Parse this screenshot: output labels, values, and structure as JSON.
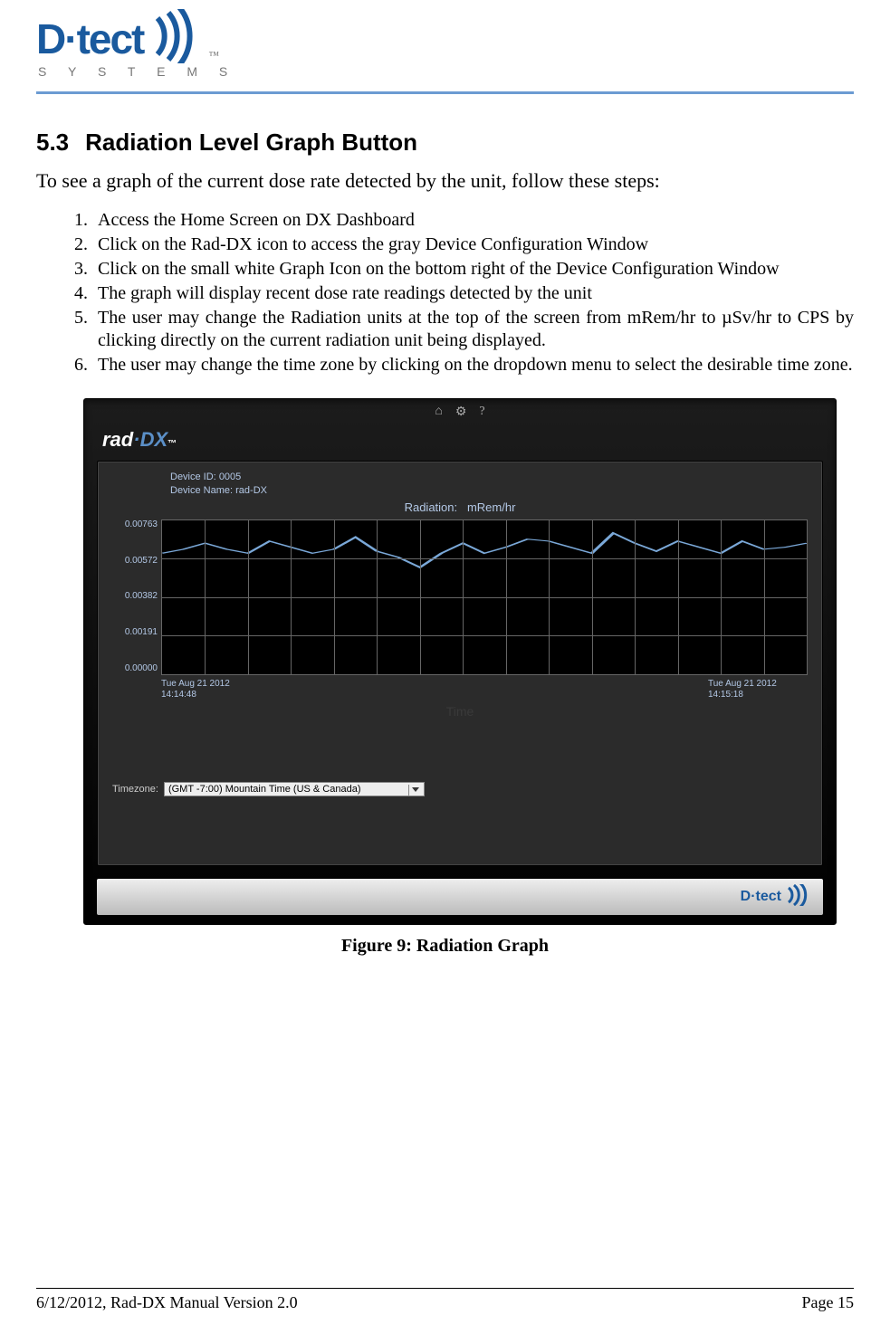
{
  "header": {
    "logo_main": "D·tect",
    "logo_sub": "S Y S T E M S",
    "tm": "™"
  },
  "section": {
    "number": "5.3",
    "title": "Radiation Level Graph Button"
  },
  "intro": "To see a graph of the current dose rate detected by the unit, follow these steps:",
  "steps": [
    "Access the Home Screen on DX Dashboard",
    "Click on the Rad-DX icon to access the gray Device Configuration Window",
    "Click on the small white Graph Icon on the bottom right of the Device Configuration Window",
    "The graph will display recent dose rate readings detected by the unit",
    "The user may change the Radiation units at the top of the screen from mRem/hr to µSv/hr to CPS by clicking directly on the current radiation unit being displayed.",
    "The user may change the time zone by clicking on the dropdown menu to select the desirable time zone."
  ],
  "app": {
    "topbar_icons": [
      "home-icon",
      "gear-icon",
      "help-icon"
    ],
    "logo_rad": "rad",
    "logo_dx": "DX",
    "logo_tm": "™",
    "device_id_label": "Device ID:",
    "device_id_value": "0005",
    "device_name_label": "Device Name:",
    "device_name_value": "rad-DX",
    "chart_title_label": "Radiation:",
    "chart_title_unit": "mRem/hr",
    "x_label": "Time",
    "x_start_date": "Tue Aug 21 2012",
    "x_start_time": "14:14:48",
    "x_end_date": "Tue Aug 21 2012",
    "x_end_time": "14:15:18",
    "timezone_label": "Timezone:",
    "timezone_value": "(GMT -7:00) Mountain Time (US & Canada)",
    "brand_text": "D·tect"
  },
  "chart_data": {
    "type": "line",
    "title": "Radiation:   mRem/hr",
    "xlabel": "Time",
    "ylabel": "",
    "ylim": [
      0,
      0.00763
    ],
    "y_ticks": [
      "0.00763",
      "0.00572",
      "0.00382",
      "0.00191",
      "0.00000"
    ],
    "x_range": [
      "Tue Aug 21 2012 14:14:48",
      "Tue Aug 21 2012 14:15:18"
    ],
    "x": [
      0,
      1,
      2,
      3,
      4,
      5,
      6,
      7,
      8,
      9,
      10,
      11,
      12,
      13,
      14,
      15,
      16,
      17,
      18,
      19,
      20,
      21,
      22,
      23,
      24,
      25,
      26,
      27,
      28,
      29,
      30
    ],
    "values": [
      0.006,
      0.0062,
      0.0065,
      0.0062,
      0.006,
      0.0066,
      0.0063,
      0.006,
      0.0062,
      0.0068,
      0.0061,
      0.0058,
      0.0053,
      0.006,
      0.0065,
      0.006,
      0.0063,
      0.0067,
      0.0066,
      0.0063,
      0.006,
      0.007,
      0.0065,
      0.0061,
      0.0066,
      0.0063,
      0.006,
      0.0066,
      0.0062,
      0.0063,
      0.0065
    ]
  },
  "figure_caption": "Figure 9: Radiation Graph",
  "footer": {
    "left": "6/12/2012, Rad-DX Manual Version 2.0",
    "right": "Page 15"
  }
}
